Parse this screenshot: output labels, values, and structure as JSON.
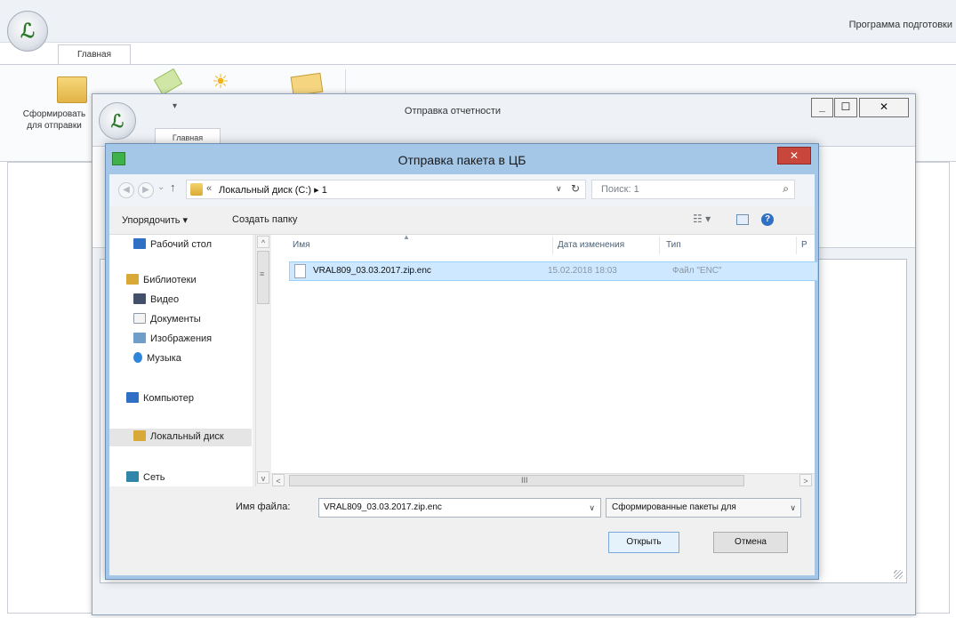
{
  "app": {
    "title": "Программа подготовки",
    "tab": "Главная",
    "ribbon_label": "Сформировать для отправки",
    "logo_icon": "app-logo-icon"
  },
  "report_window": {
    "title": "Отправка отчетности",
    "tab": "Главная",
    "qat": "▾",
    "min": "_",
    "max": "☐",
    "close": "✕"
  },
  "dialog": {
    "title": "Отправка пакета в ЦБ",
    "close": "✕",
    "address": {
      "path": "Локальный диск (C:)  ▸  1",
      "prefix": "«",
      "dropdown": "∨",
      "refresh": "↻"
    },
    "search": {
      "placeholder": "Поиск: 1",
      "icon": "⌕"
    },
    "toolbar": {
      "organize": "Упорядочить  ▾",
      "new_folder": "Создать папку",
      "views": "☷  ▾",
      "help": "?"
    },
    "nav": {
      "items": [
        {
          "label": "Рабочий стол",
          "icon": "desktop-icon",
          "color": "#2f6fc4"
        },
        {
          "label": "Библиотеки",
          "icon": "libraries-icon",
          "color": "#d9a938"
        },
        {
          "label": "Видео",
          "icon": "video-icon",
          "color": "#44506a"
        },
        {
          "label": "Документы",
          "icon": "documents-icon",
          "color": "#f4f4f4"
        },
        {
          "label": "Изображения",
          "icon": "pictures-icon",
          "color": "#6f9ec9"
        },
        {
          "label": "Музыка",
          "icon": "music-icon",
          "color": "#2f86d8"
        },
        {
          "label": "Компьютер",
          "icon": "computer-icon",
          "color": "#2f6fc4"
        },
        {
          "label": "Локальный диск",
          "icon": "local-disk-icon",
          "color": "#d9a938"
        },
        {
          "label": "Сеть",
          "icon": "network-icon",
          "color": "#2f86a8"
        }
      ]
    },
    "columns": {
      "name": "Имя",
      "date": "Дата изменения",
      "type": "Тип",
      "size": "Р"
    },
    "files": [
      {
        "name": "VRAL809_03.03.2017.zip.enc",
        "date": "15.02.2018 18:03",
        "type": "Файл \"ENC\""
      }
    ],
    "filename_label": "Имя файла:",
    "filename_value": "VRAL809_03.03.2017.zip.enc",
    "filter": "Сформированные пакеты для",
    "open_button": "Открыть",
    "cancel_button": "Отмена",
    "scroll": {
      "up": "^",
      "down": "v",
      "left": "<",
      "right": ">",
      "grip": "III",
      "mid": "≡"
    }
  }
}
